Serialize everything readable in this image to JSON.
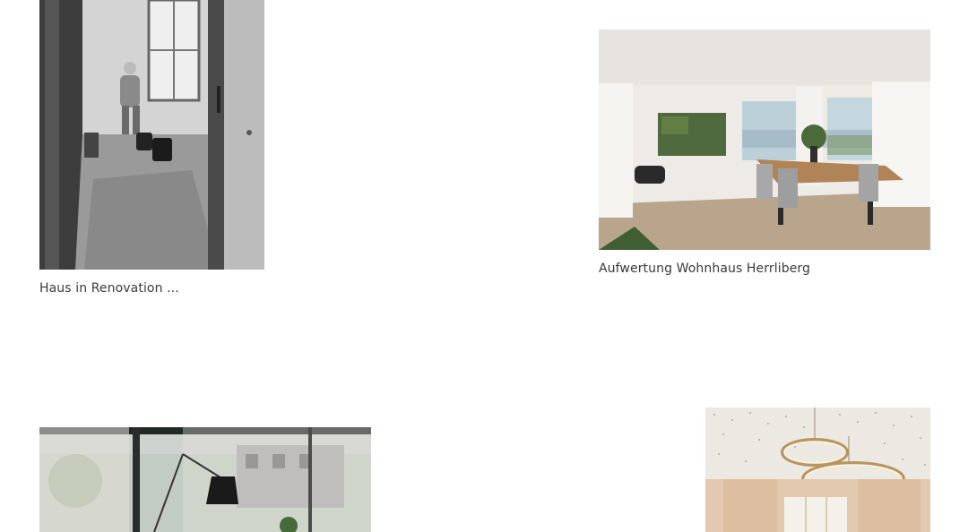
{
  "projects": [
    {
      "id": "renovation",
      "caption": "Haus in Renovation ..."
    },
    {
      "id": "herrliberg",
      "caption": "Aufwertung Wohnhaus Herrliberg"
    },
    {
      "id": "living-lamp",
      "caption": ""
    },
    {
      "id": "ring-lights",
      "caption": ""
    }
  ]
}
